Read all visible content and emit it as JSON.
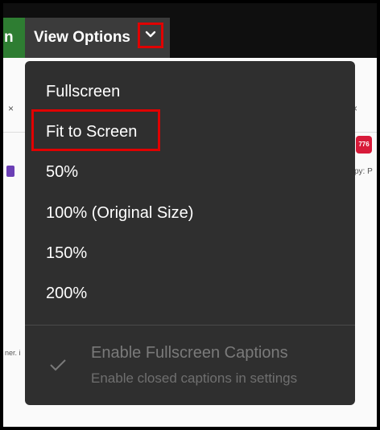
{
  "toolbar": {
    "partial_tab_text": "n",
    "view_options_label": "View Options",
    "chevron_icon": "chevron-down-icon"
  },
  "background": {
    "close_left": "×",
    "close_right": "×",
    "right_badge": "776",
    "right_text": "py: P",
    "left_text": "ner. i"
  },
  "menu": {
    "items": [
      {
        "label": "Fullscreen"
      },
      {
        "label": "Fit to Screen",
        "highlighted": true
      },
      {
        "label": "50%"
      },
      {
        "label": "100% (Original Size)"
      },
      {
        "label": "150%"
      },
      {
        "label": "200%"
      }
    ],
    "captions": {
      "title": "Enable Fullscreen Captions",
      "subtitle": "Enable closed captions in settings",
      "icon": "checkmark-icon",
      "disabled": true
    }
  },
  "colors": {
    "menu_bg": "#2f2f2f",
    "topbar_bg": "#0f0f0f",
    "button_bg": "#3b3b3b",
    "highlight_border": "#e00000",
    "green_tab": "#2e7d32"
  }
}
